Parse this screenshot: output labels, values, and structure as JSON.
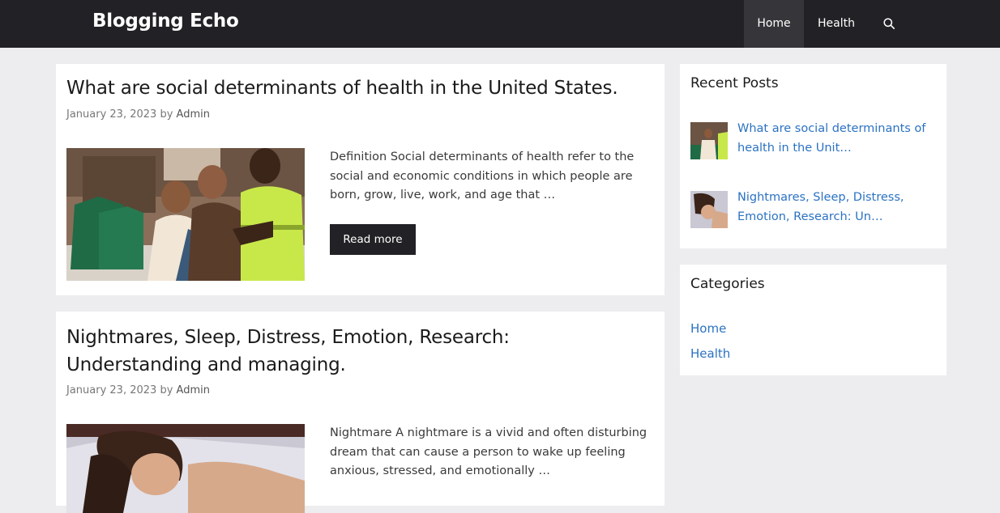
{
  "site": {
    "title": "Blogging Echo"
  },
  "nav": {
    "items": [
      {
        "label": "Home",
        "active": true
      },
      {
        "label": "Health",
        "active": false
      }
    ],
    "search_icon": "search-icon"
  },
  "posts": [
    {
      "title": "What are social determinants of health in the United States.",
      "date": "January 23, 2023",
      "by": "by",
      "author": "Admin",
      "excerpt": "Definition Social determinants of health refer to the social and economic conditions in which people are born, grow, live, work, and age that …",
      "read_more": "Read more"
    },
    {
      "title": "Nightmares, Sleep, Distress, Emotion, Research: Understanding and managing.",
      "date": "January 23, 2023",
      "by": "by",
      "author": "Admin",
      "excerpt": "Nightmare A nightmare is a vivid and often disturbing dream that can cause a person to wake up feeling anxious, stressed, and emotionally …"
    }
  ],
  "sidebar": {
    "recent": {
      "title": "Recent Posts",
      "items": [
        {
          "label": "What are social determinants of health in the Unit…"
        },
        {
          "label": "Nightmares, Sleep, Distress, Emotion, Research: Un…"
        }
      ]
    },
    "categories": {
      "title": "Categories",
      "items": [
        {
          "label": "Home"
        },
        {
          "label": "Health"
        }
      ]
    }
  },
  "colors": {
    "header": "#222226",
    "background": "#edecee",
    "link": "#2b72c2",
    "button": "#222226"
  }
}
